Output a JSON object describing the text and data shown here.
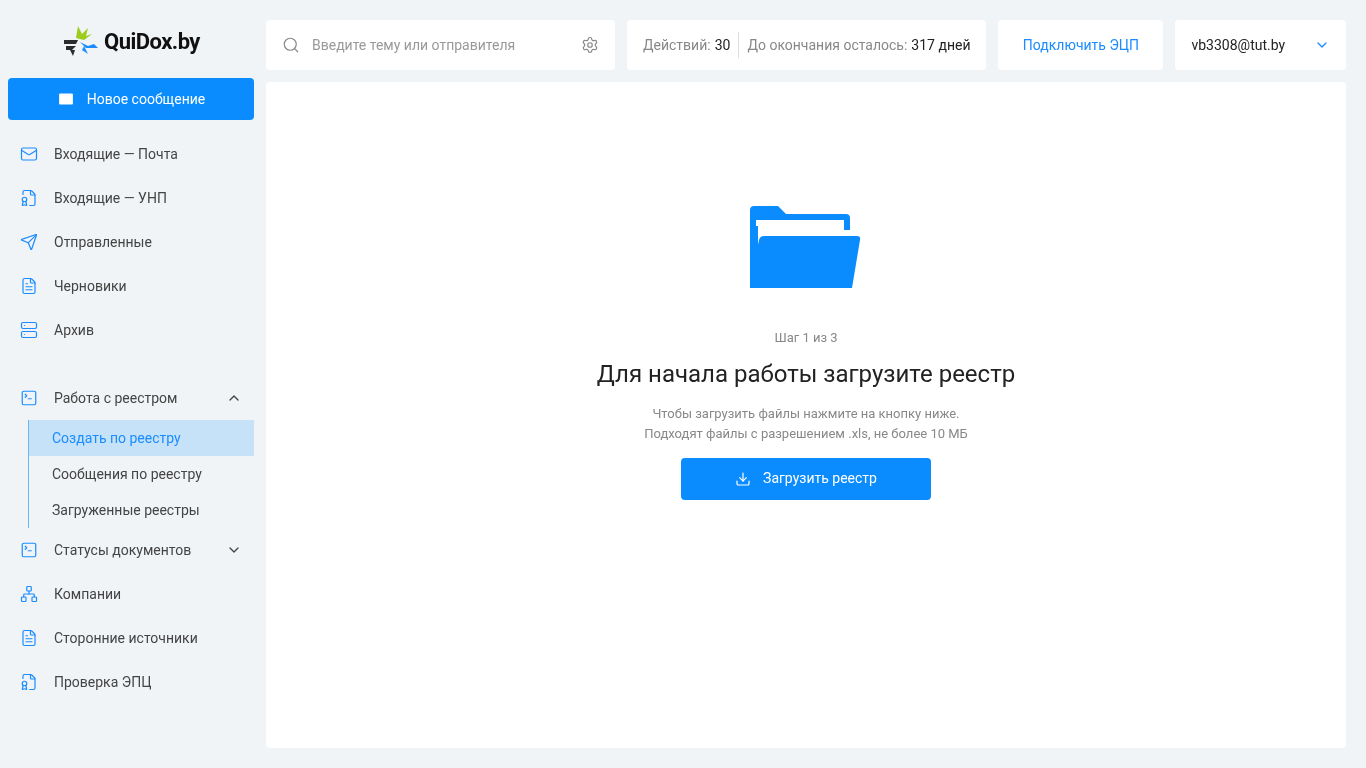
{
  "logo": {
    "text": "QuiDox.by"
  },
  "new_message_button": {
    "label": "Новое сообщение"
  },
  "nav": [
    {
      "kind": "item",
      "label": "Входящие — Почта",
      "selected": false
    },
    {
      "kind": "item",
      "label": "Входящие — УНП",
      "selected": false
    },
    {
      "kind": "item",
      "label": "Отправленные",
      "selected": false
    },
    {
      "kind": "item",
      "label": "Черновики",
      "selected": false
    },
    {
      "kind": "item",
      "label": "Архив",
      "selected": false
    },
    {
      "kind": "spacer"
    },
    {
      "kind": "group",
      "label": "Работа с реестром",
      "expanded": true,
      "children": [
        {
          "label": "Создать по реестру",
          "selected": true
        },
        {
          "label": "Сообщения по реестру",
          "selected": false
        },
        {
          "label": "Загруженные реестры",
          "selected": false
        }
      ]
    },
    {
      "kind": "group",
      "label": "Статусы документов",
      "expanded": false
    },
    {
      "kind": "item",
      "label": "Компании",
      "selected": false
    },
    {
      "kind": "item",
      "label": "Сторонние источники",
      "selected": false
    },
    {
      "kind": "item",
      "label": "Проверка ЭПЦ",
      "selected": false
    }
  ],
  "search": {
    "placeholder": "Введите тему или отправителя"
  },
  "stats": [
    {
      "label": "Действий:",
      "value": "30"
    },
    {
      "label": "До окончания осталось:",
      "value": "317 дней"
    }
  ],
  "connect_link": {
    "label": "Подключить ЭЦП"
  },
  "account": {
    "email": "vb3308@tut.by"
  },
  "upload": {
    "step": "Шаг 1 из 3",
    "title": "Для начала работы загрузите реестр",
    "hint_lines": [
      "Чтобы загрузить файлы нажмите на кнопку ниже.",
      "Подходят файлы с разрешением .xls, не более 10 МБ"
    ],
    "button": "Загрузить реестр"
  }
}
